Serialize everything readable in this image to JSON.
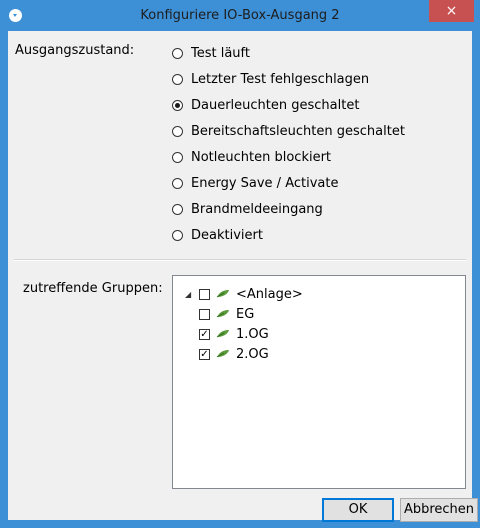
{
  "window": {
    "title": "Konfiguriere IO-Box-Ausgang 2",
    "close_symbol": "×",
    "accent_color": "#3d8fd6",
    "close_color": "#c75050"
  },
  "output_state": {
    "label": "Ausgangszustand:",
    "selected": "Dauerleuchten geschaltet",
    "options": [
      {
        "label": "Test läuft",
        "checked": false
      },
      {
        "label": "Letzter Test fehlgeschlagen",
        "checked": false
      },
      {
        "label": "Dauerleuchten geschaltet",
        "checked": true
      },
      {
        "label": "Bereitschaftsleuchten geschaltet",
        "checked": false
      },
      {
        "label": "Notleuchten blockiert",
        "checked": false
      },
      {
        "label": "Energy Save / Activate",
        "checked": false
      },
      {
        "label": "Brandmeldeeingang",
        "checked": false
      },
      {
        "label": "Deaktiviert",
        "checked": false
      }
    ]
  },
  "groups": {
    "label": "zutreffende Gruppen:",
    "tree": [
      {
        "label": "<Anlage>",
        "checked": false,
        "expanded": true,
        "icon": "leaf-icon",
        "level": 0
      },
      {
        "label": "EG",
        "checked": false,
        "icon": "leaf-icon",
        "level": 1
      },
      {
        "label": "1.OG",
        "checked": true,
        "icon": "leaf-icon",
        "level": 1
      },
      {
        "label": "2.OG",
        "checked": true,
        "icon": "leaf-icon",
        "level": 1
      }
    ]
  },
  "buttons": {
    "ok": "OK",
    "cancel": "Abbrechen"
  }
}
